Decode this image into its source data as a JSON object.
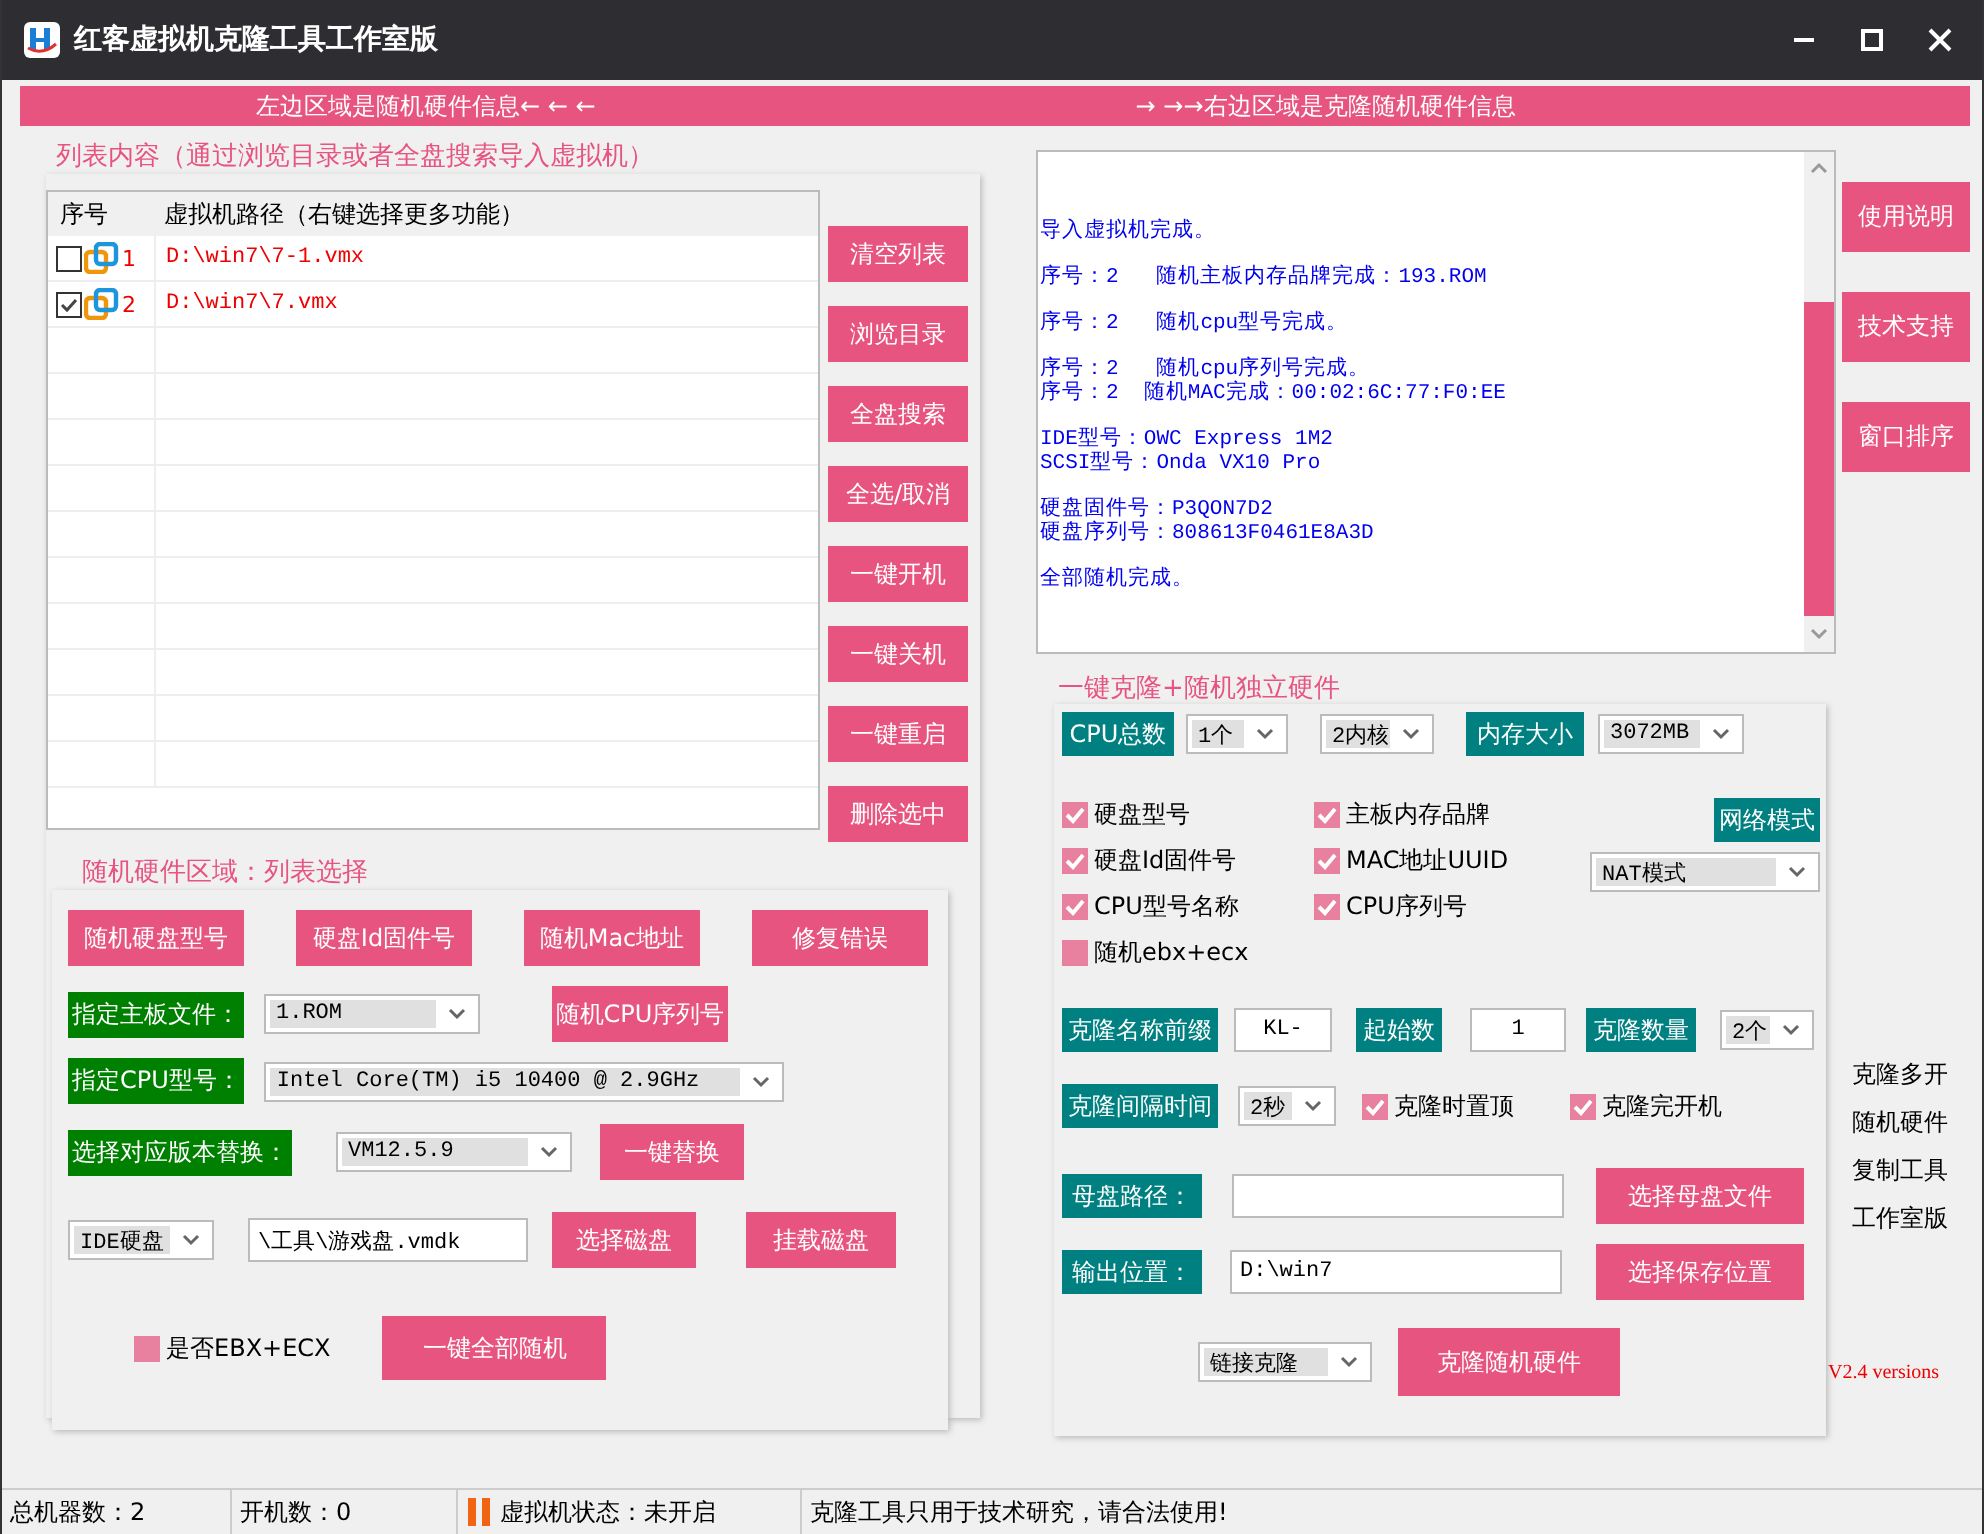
{
  "window": {
    "title": "红客虚拟机克隆工具工作室版"
  },
  "banner": {
    "left": "左边区域是随机硬件信息← ← ←",
    "right": "→ →→右边区域是克隆随机硬件信息"
  },
  "vm_list": {
    "label": "列表内容（通过浏览目录或者全盘搜索导入虚拟机）",
    "columns": [
      "序号",
      "虚拟机路径（右键选择更多功能）"
    ],
    "rows": [
      {
        "index": "1",
        "path": "D:\\win7\\7-1.vmx",
        "checked": false
      },
      {
        "index": "2",
        "path": "D:\\win7\\7.vmx",
        "checked": true
      }
    ]
  },
  "list_buttons": [
    "清空列表",
    "浏览目录",
    "全盘搜索",
    "全选/取消",
    "一键开机",
    "一键关机",
    "一键重启",
    "删除选中"
  ],
  "hardware": {
    "label": "随机硬件区域：列表选择",
    "buttons": [
      "随机硬盘型号",
      "硬盘Id固件号",
      "随机Mac地址",
      "修复错误"
    ],
    "board_file": {
      "label": "指定主板文件：",
      "value": "1.ROM"
    },
    "cpu_serial_button": "随机CPU序列号",
    "cpu_model": {
      "label": "指定CPU型号：",
      "value": "Intel Core(TM) i5 10400 @ 2.9GHz"
    },
    "version": {
      "label": "选择对应版本替换：",
      "value": "VM12.5.9",
      "button": "一键替换"
    },
    "disk": {
      "type": "IDE硬盘",
      "path": "\\工具\\游戏盘.vmdk",
      "buttons": [
        "选择磁盘",
        "挂载磁盘"
      ]
    },
    "ebx": {
      "label": "是否EBX+ECX",
      "checked": false
    },
    "random_all_button": "一键全部随机"
  },
  "log": {
    "paragraphs": [
      [
        "导入虚拟机完成。"
      ],
      [
        "序号：2   随机主板内存品牌完成：193.ROM"
      ],
      [
        "序号：2   随机cpu型号完成。"
      ],
      [
        "序号：2   随机cpu序列号完成。",
        "序号：2  随机MAC完成：00:02:6C:77:F0:EE"
      ],
      [
        "IDE型号：OWC Express 1M2",
        "SCSI型号：Onda VX10 Pro"
      ],
      [
        "硬盘固件号：P3QON7D2",
        "硬盘序列号：808613F0461E8A3D"
      ],
      [
        "全部随机完成。"
      ]
    ]
  },
  "side_buttons": [
    "使用说明",
    "技术支持",
    "窗口排序"
  ],
  "clone": {
    "label": "一键克隆+随机独立硬件",
    "cpu": {
      "label": "CPU总数",
      "count": "1个",
      "cores": "2内核"
    },
    "memory": {
      "label": "内存大小",
      "value": "3072MB"
    },
    "options": [
      {
        "label": "硬盘型号",
        "checked": true
      },
      {
        "label": "主板内存品牌",
        "checked": true
      },
      {
        "label": "硬盘Id固件号",
        "checked": true
      },
      {
        "label": "MAC地址UUID",
        "checked": true
      },
      {
        "label": "CPU型号名称",
        "checked": true
      },
      {
        "label": "CPU序列号",
        "checked": true
      },
      {
        "label": "随机ebx+ecx",
        "checked": false
      }
    ],
    "network": {
      "label": "网络模式",
      "value": "NAT模式"
    },
    "prefix": {
      "label": "克隆名称前缀",
      "value": "KL-"
    },
    "start": {
      "label": "起始数",
      "value": "1"
    },
    "count": {
      "label": "克隆数量",
      "value": "2个"
    },
    "interval": {
      "label": "克隆间隔时间",
      "value": "2秒"
    },
    "flags": [
      {
        "label": "克隆时置顶",
        "checked": true
      },
      {
        "label": "克隆完开机",
        "checked": true
      }
    ],
    "parent_disk": {
      "label": "母盘路径：",
      "button": "选择母盘文件"
    },
    "output": {
      "label": "输出位置：",
      "value": "D:\\win7",
      "button": "选择保存位置"
    },
    "mode": "链接克隆",
    "clone_button": "克隆随机硬件"
  },
  "side_notes": [
    "克隆多开",
    "随机硬件",
    "复制工具",
    "工作室版"
  ],
  "version": "V2.4 versions",
  "status_bar": {
    "machines": "总机器数：2",
    "running": "开机数：0",
    "vm_state": "虚拟机状态：未开启",
    "notice": "克隆工具只用于技术研究，请合法使用!"
  }
}
